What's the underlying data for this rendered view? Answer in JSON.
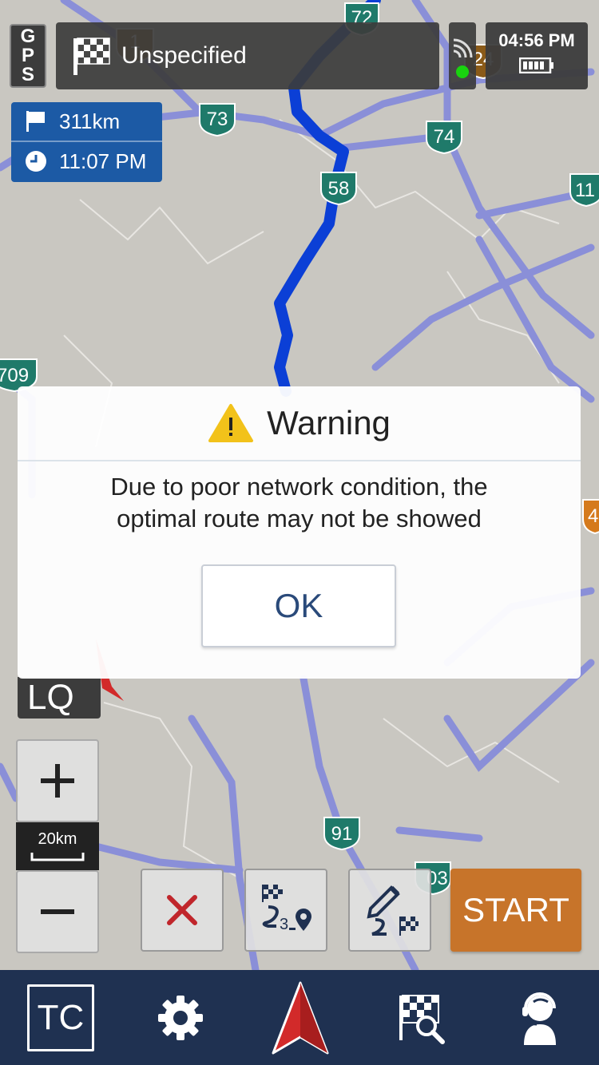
{
  "status": {
    "gps_label": [
      "G",
      "P",
      "S"
    ],
    "destination": "Unspecified",
    "time": "04:56 PM"
  },
  "trip": {
    "distance": "311km",
    "eta": "11:07 PM"
  },
  "map": {
    "highway_labels": [
      "72",
      "73",
      "74",
      "58",
      "11",
      "709",
      "91",
      "03",
      "1",
      "24",
      "4"
    ]
  },
  "dialog": {
    "title": "Warning",
    "message_line1": "Due to poor network condition, the",
    "message_line2": "optimal route may not be showed",
    "ok_label": "OK"
  },
  "controls": {
    "lq_label": "LQ",
    "zoom_scale": "20km",
    "start_label": "START"
  },
  "bottom_nav": {
    "tc_label": "TC"
  },
  "colors": {
    "route": "#0b3fd6",
    "nav_bg": "#1f3151",
    "trip_box": "#1c5aa5",
    "start": "#c7742a",
    "highway_shield": "#1f7a6a"
  }
}
